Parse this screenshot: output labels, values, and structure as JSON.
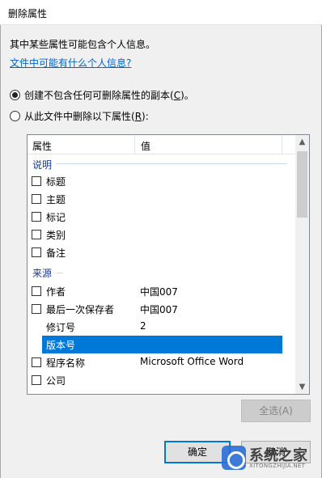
{
  "window": {
    "title": "删除属性"
  },
  "intro_text": "其中某些属性可能包含个人信息。",
  "info_link": "文件中可能有什么个人信息?",
  "options": [
    {
      "label_pre": "创建不包含任何可删除属性的副本(",
      "key": "C",
      "label_post": ")。",
      "checked": true
    },
    {
      "label_pre": "从此文件中删除以下属性(",
      "key": "R",
      "label_post": "):",
      "checked": false
    }
  ],
  "list": {
    "headers": {
      "property": "属性",
      "value": "值"
    },
    "groups": [
      {
        "name": "说明",
        "items": [
          {
            "name": "标题",
            "value": "",
            "checkbox": true
          },
          {
            "name": "主题",
            "value": "",
            "checkbox": true
          },
          {
            "name": "标记",
            "value": "",
            "checkbox": true
          },
          {
            "name": "类别",
            "value": "",
            "checkbox": true
          },
          {
            "name": "备注",
            "value": "",
            "checkbox": true
          }
        ]
      },
      {
        "name": "来源",
        "items": [
          {
            "name": "作者",
            "value": "中国007",
            "checkbox": true
          },
          {
            "name": "最后一次保存者",
            "value": "中国007",
            "checkbox": true
          },
          {
            "name": "修订号",
            "value": "2",
            "checkbox": false
          },
          {
            "name": "版本号",
            "value": "",
            "checkbox": false,
            "selected": true
          },
          {
            "name": "程序名称",
            "value": "Microsoft Office Word",
            "checkbox": true
          },
          {
            "name": "公司",
            "value": "",
            "checkbox": true
          }
        ]
      }
    ],
    "selected_color": "#0078d7"
  },
  "buttons": {
    "select_all": "全选(A)",
    "ok": "确定",
    "cancel": "取消"
  },
  "watermark": {
    "text": "系统之家",
    "sub": "XITONGZHIJIA.NET"
  }
}
